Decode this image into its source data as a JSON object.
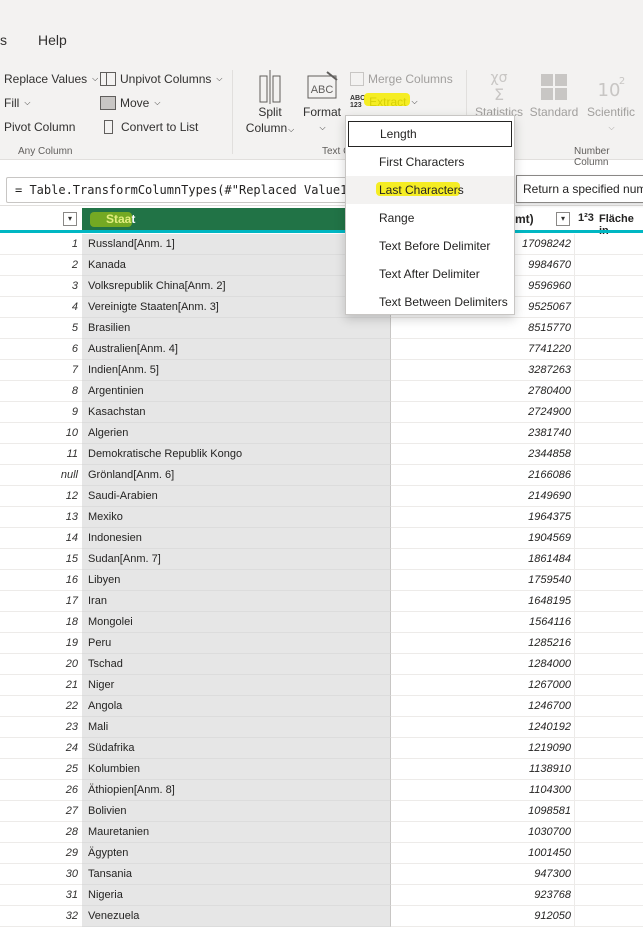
{
  "menubar": {
    "items": [
      "s",
      "Help"
    ]
  },
  "ribbon": {
    "replace_values": "Replace Values",
    "fill": "Fill",
    "pivot_column": "Pivot Column",
    "unpivot_columns": "Unpivot Columns",
    "move": "Move",
    "convert_to_list": "Convert to List",
    "group_any_column": "Any Column",
    "split_column_1": "Split",
    "split_column_2": "Column",
    "format": "Format",
    "merge_columns": "Merge Columns",
    "extract": "Extract",
    "group_text": "Text C",
    "statistics": "Statistics",
    "standard": "Standard",
    "scientific": "Scientific",
    "group_number": "Number Column",
    "extract_icon_text_top": "ABC",
    "extract_icon_text_bottom": "123"
  },
  "formula": {
    "text": "= Table.TransformColumnTypes(#\"Replaced Value1\",{{"
  },
  "tooltip": {
    "text": "Return a specified num"
  },
  "extract_menu": {
    "items": [
      "Length",
      "First Characters",
      "Last Characters",
      "Range",
      "Text Before Delimiter",
      "Text After Delimiter",
      "Text Between Delimiters"
    ]
  },
  "grid": {
    "headers": {
      "staat": "Staat",
      "area_suffix": "mt)",
      "flaeche_type": "1²3",
      "flaeche": "Fläche in"
    },
    "rows": [
      {
        "idx": "1",
        "staat": "Russland[Anm. 1]",
        "area": "17098242"
      },
      {
        "idx": "2",
        "staat": "Kanada",
        "area": "9984670"
      },
      {
        "idx": "3",
        "staat": "Volksrepublik China[Anm. 2]",
        "area": "9596960"
      },
      {
        "idx": "4",
        "staat": "Vereinigte Staaten[Anm. 3]",
        "area": "9525067"
      },
      {
        "idx": "5",
        "staat": "Brasilien",
        "area": "8515770"
      },
      {
        "idx": "6",
        "staat": "Australien[Anm. 4]",
        "area": "7741220"
      },
      {
        "idx": "7",
        "staat": "Indien[Anm. 5]",
        "area": "3287263"
      },
      {
        "idx": "8",
        "staat": "Argentinien",
        "area": "2780400"
      },
      {
        "idx": "9",
        "staat": "Kasachstan",
        "area": "2724900"
      },
      {
        "idx": "10",
        "staat": "Algerien",
        "area": "2381740"
      },
      {
        "idx": "11",
        "staat": "Demokratische Republik Kongo",
        "area": "2344858"
      },
      {
        "idx": "null",
        "staat": "Grönland[Anm. 6]",
        "area": "2166086"
      },
      {
        "idx": "12",
        "staat": "Saudi-Arabien",
        "area": "2149690"
      },
      {
        "idx": "13",
        "staat": "Mexiko",
        "area": "1964375"
      },
      {
        "idx": "14",
        "staat": "Indonesien",
        "area": "1904569"
      },
      {
        "idx": "15",
        "staat": "Sudan[Anm. 7]",
        "area": "1861484"
      },
      {
        "idx": "16",
        "staat": "Libyen",
        "area": "1759540"
      },
      {
        "idx": "17",
        "staat": "Iran",
        "area": "1648195"
      },
      {
        "idx": "18",
        "staat": "Mongolei",
        "area": "1564116"
      },
      {
        "idx": "19",
        "staat": "Peru",
        "area": "1285216"
      },
      {
        "idx": "20",
        "staat": "Tschad",
        "area": "1284000"
      },
      {
        "idx": "21",
        "staat": "Niger",
        "area": "1267000"
      },
      {
        "idx": "22",
        "staat": "Angola",
        "area": "1246700"
      },
      {
        "idx": "23",
        "staat": "Mali",
        "area": "1240192"
      },
      {
        "idx": "24",
        "staat": "Südafrika",
        "area": "1219090"
      },
      {
        "idx": "25",
        "staat": "Kolumbien",
        "area": "1138910"
      },
      {
        "idx": "26",
        "staat": "Äthiopien[Anm. 8]",
        "area": "1104300"
      },
      {
        "idx": "27",
        "staat": "Bolivien",
        "area": "1098581"
      },
      {
        "idx": "28",
        "staat": "Mauretanien",
        "area": "1030700"
      },
      {
        "idx": "29",
        "staat": "Ägypten",
        "area": "1001450"
      },
      {
        "idx": "30",
        "staat": "Tansania",
        "area": "947300"
      },
      {
        "idx": "31",
        "staat": "Nigeria",
        "area": "923768"
      },
      {
        "idx": "32",
        "staat": "Venezuela",
        "area": "912050"
      }
    ]
  },
  "colors": {
    "selected_header": "#217346",
    "accent_bar": "#00b7c3",
    "highlight": "#f5ec00"
  }
}
